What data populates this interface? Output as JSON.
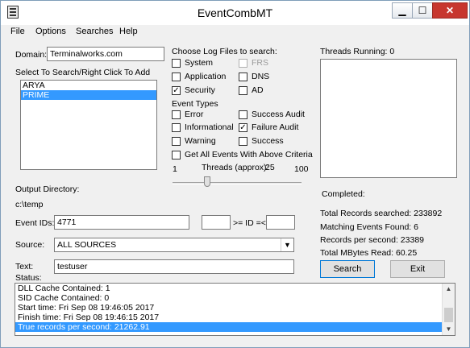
{
  "window": {
    "title": "EventCombMT"
  },
  "title_buttons": {
    "minimize": "▁",
    "maximize": "☐",
    "close": "✕"
  },
  "menu": [
    "File",
    "Options",
    "Searches",
    "Help"
  ],
  "domain": {
    "label": "Domain:",
    "value": "Terminalworks.com"
  },
  "servers": {
    "label": "Select To Search/Right Click To Add",
    "items": [
      {
        "name": "ARYA",
        "selected": false
      },
      {
        "name": "PRIME",
        "selected": true
      }
    ]
  },
  "log_files": {
    "label": "Choose Log Files to search:",
    "options": [
      {
        "label": "System",
        "checked": false,
        "disabled": false
      },
      {
        "label": "FRS",
        "checked": false,
        "disabled": true
      },
      {
        "label": "Application",
        "checked": false,
        "disabled": false
      },
      {
        "label": "DNS",
        "checked": false,
        "disabled": false
      },
      {
        "label": "Security",
        "checked": true,
        "disabled": false
      },
      {
        "label": "AD",
        "checked": false,
        "disabled": false
      }
    ]
  },
  "event_types": {
    "label": "Event Types",
    "options": [
      {
        "label": "Error",
        "checked": false
      },
      {
        "label": "Success Audit",
        "checked": false
      },
      {
        "label": "Informational",
        "checked": false
      },
      {
        "label": "Failure Audit",
        "checked": true
      },
      {
        "label": "Warning",
        "checked": false
      },
      {
        "label": "Success",
        "checked": false
      }
    ]
  },
  "get_all": {
    "label": "Get All Events With Above Criteria",
    "checked": false
  },
  "threads": {
    "min": "1",
    "label": "Threads (approx):",
    "value": "25",
    "max": "100"
  },
  "threads_running": {
    "label": "Threads Running:",
    "value": "0"
  },
  "completed": {
    "label": "Completed:"
  },
  "stats": [
    "Total Records searched: 233892",
    "Matching Events Found: 6",
    "Records per second: 23389",
    "Total MBytes Read: 60.25"
  ],
  "output_dir": {
    "label": "Output Directory:",
    "value": "c:\\temp"
  },
  "event_ids": {
    "label": "Event IDs:",
    "value": "4771",
    "range_from": "",
    "range_mid": ">= ID =<",
    "range_to": ""
  },
  "source": {
    "label": "Source:",
    "value": "ALL SOURCES"
  },
  "text_filter": {
    "label": "Text:",
    "value": "testuser"
  },
  "buttons": {
    "search": "Search",
    "exit": "Exit"
  },
  "status": {
    "label": "Status:",
    "lines": [
      {
        "text": "DLL Cache Contained: 1",
        "selected": false
      },
      {
        "text": "SID Cache Contained: 0",
        "selected": false
      },
      {
        "text": "Start time: Fri Sep 08 19:46:05 2017",
        "selected": false
      },
      {
        "text": "Finish time: Fri Sep 08 19:46:15 2017",
        "selected": false
      },
      {
        "text": "True records per second: 21262.91",
        "selected": true
      }
    ]
  },
  "scroll_glyphs": {
    "up": "▲",
    "down": "▼",
    "select_arrow": "▼"
  }
}
